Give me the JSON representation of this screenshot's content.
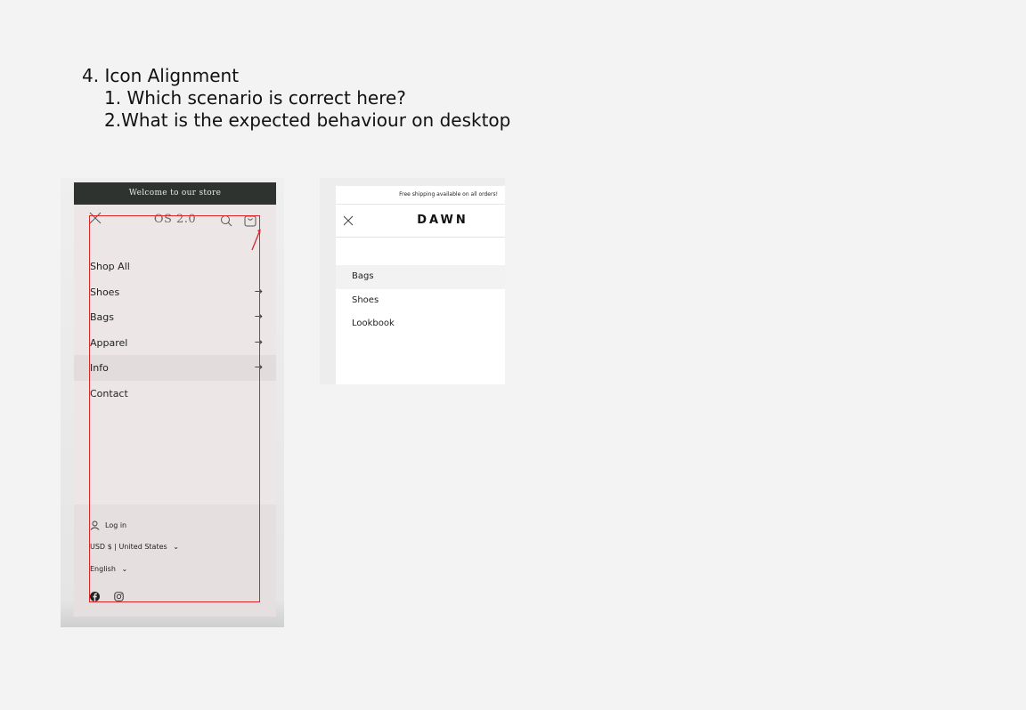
{
  "notes": {
    "title": "4. Icon Alignment",
    "q1": "1. Which scenario is correct here?",
    "q2": "2.What is the expected behaviour on desktop"
  },
  "left_mockup": {
    "announcement": "Welcome to our store",
    "logo": "OS 2.0",
    "menu": [
      {
        "label": "Shop All",
        "arrow": ""
      },
      {
        "label": "Shoes",
        "arrow": "→"
      },
      {
        "label": "Bags",
        "arrow": "→"
      },
      {
        "label": "Apparel",
        "arrow": "→"
      },
      {
        "label": "Info",
        "arrow": "→"
      },
      {
        "label": "Contact",
        "arrow": ""
      }
    ],
    "active_item": "Info",
    "footer": {
      "login": "Log in",
      "currency": "USD $ | United States",
      "language": "English",
      "dropdown_glyph": "⌄"
    },
    "icons": [
      "close-icon",
      "search-icon",
      "cart-icon",
      "user-icon",
      "facebook-icon",
      "instagram-icon"
    ],
    "highlight_color": "#d9262b"
  },
  "right_mockup": {
    "shipping": "Free shipping available on all orders!",
    "logo": "DAWN",
    "menu": [
      {
        "label": "Bags"
      },
      {
        "label": "Shoes"
      },
      {
        "label": "Lookbook"
      }
    ],
    "active_item": "Bags"
  }
}
